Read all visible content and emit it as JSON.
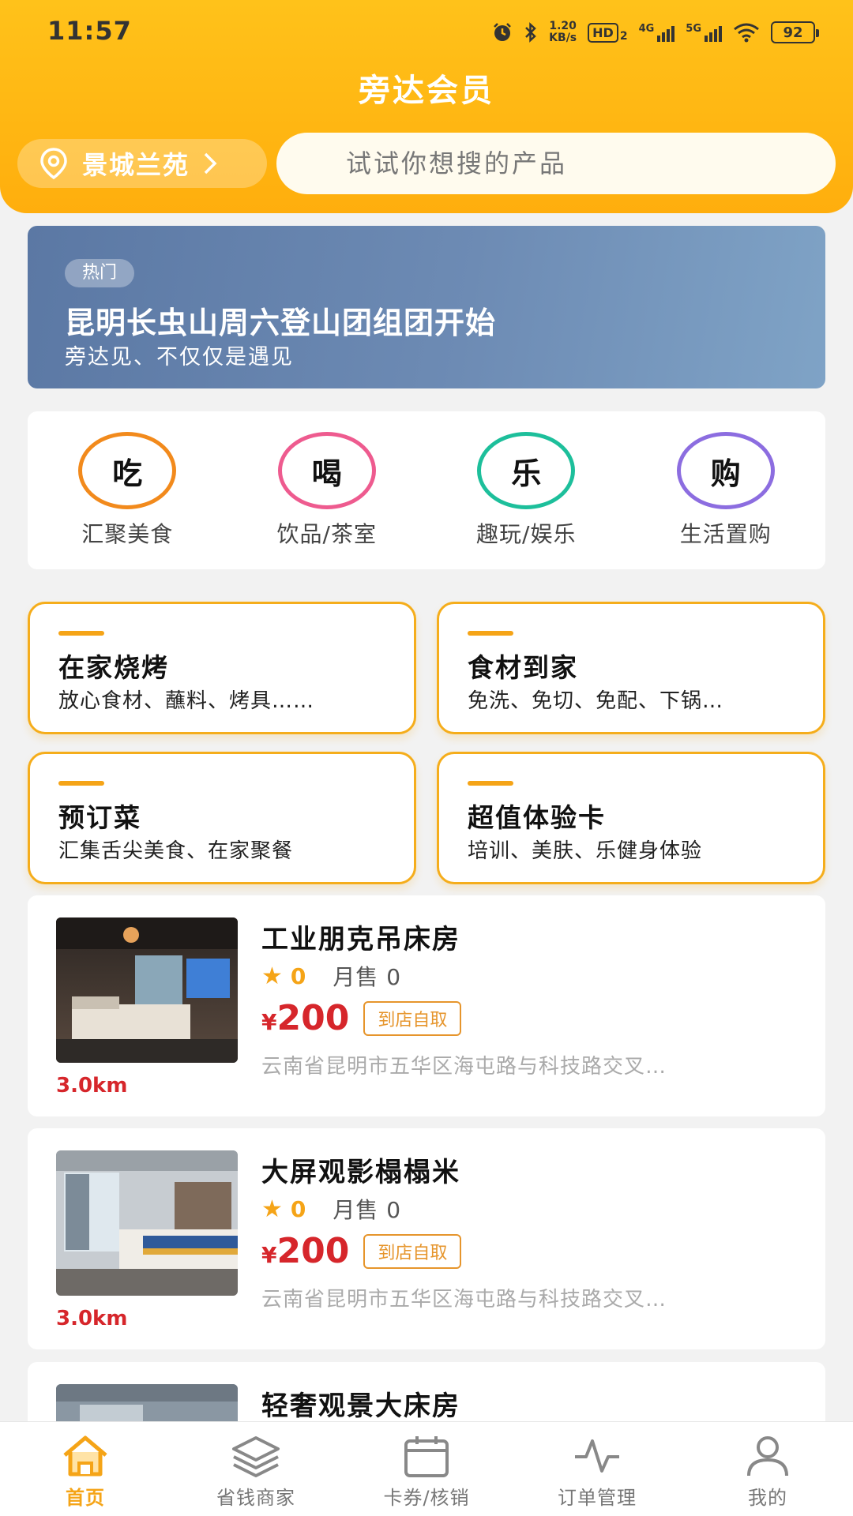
{
  "status_bar": {
    "time": "11:57",
    "net_speed_value": "1.20",
    "net_speed_unit": "KB/s",
    "hd_label": "HD",
    "hd_sub": "2",
    "sig1_label": "4G",
    "sig2_label": "5G",
    "battery": "92"
  },
  "header": {
    "title": "旁达会员",
    "location": "景城兰苑",
    "search_placeholder": "试试你想搜的产品"
  },
  "banner": {
    "tag": "热门",
    "title": "昆明长虫山周六登山团组团开始",
    "subtitle": "旁达见、不仅仅是遇见"
  },
  "categories": [
    {
      "char": "吃",
      "label": "汇聚美食",
      "color": "#f28a1c"
    },
    {
      "char": "喝",
      "label": "饮品/茶室",
      "color": "#ee5b8f"
    },
    {
      "char": "乐",
      "label": "趣玩/娱乐",
      "color": "#1dbf9b"
    },
    {
      "char": "购",
      "label": "生活置购",
      "color": "#8c6de0"
    }
  ],
  "features": [
    {
      "title": "在家烧烤",
      "subtitle": "放心食材、蘸料、烤具……"
    },
    {
      "title": "食材到家",
      "subtitle": "免洗、免切、免配、下锅…"
    },
    {
      "title": "预订菜",
      "subtitle": "汇集舌尖美食、在家聚餐"
    },
    {
      "title": "超值体验卡",
      "subtitle": "培训、美肤、乐健身体验"
    }
  ],
  "products": [
    {
      "name": "工业朋克吊床房",
      "score": "0",
      "sold": "月售 0",
      "currency": "¥",
      "price": "200",
      "pickup": "到店自取",
      "address": "云南省昆明市五华区海屯路与科技路交叉…",
      "distance": "3.0km"
    },
    {
      "name": "大屏观影榻榻米",
      "score": "0",
      "sold": "月售 0",
      "currency": "¥",
      "price": "200",
      "pickup": "到店自取",
      "address": "云南省昆明市五华区海屯路与科技路交叉…",
      "distance": "3.0km"
    },
    {
      "name": "轻奢观景大床房"
    }
  ],
  "tabs": [
    {
      "label": "首页",
      "icon": "home-icon",
      "active": true
    },
    {
      "label": "省钱商家",
      "icon": "layers-icon"
    },
    {
      "label": "卡券/核销",
      "icon": "calendar-icon"
    },
    {
      "label": "订单管理",
      "icon": "activity-icon"
    },
    {
      "label": "我的",
      "icon": "user-icon"
    }
  ],
  "colors": {
    "accent": "#f5a417",
    "header_gradient_top": "#ffc21a",
    "price_red": "#d6262b"
  }
}
